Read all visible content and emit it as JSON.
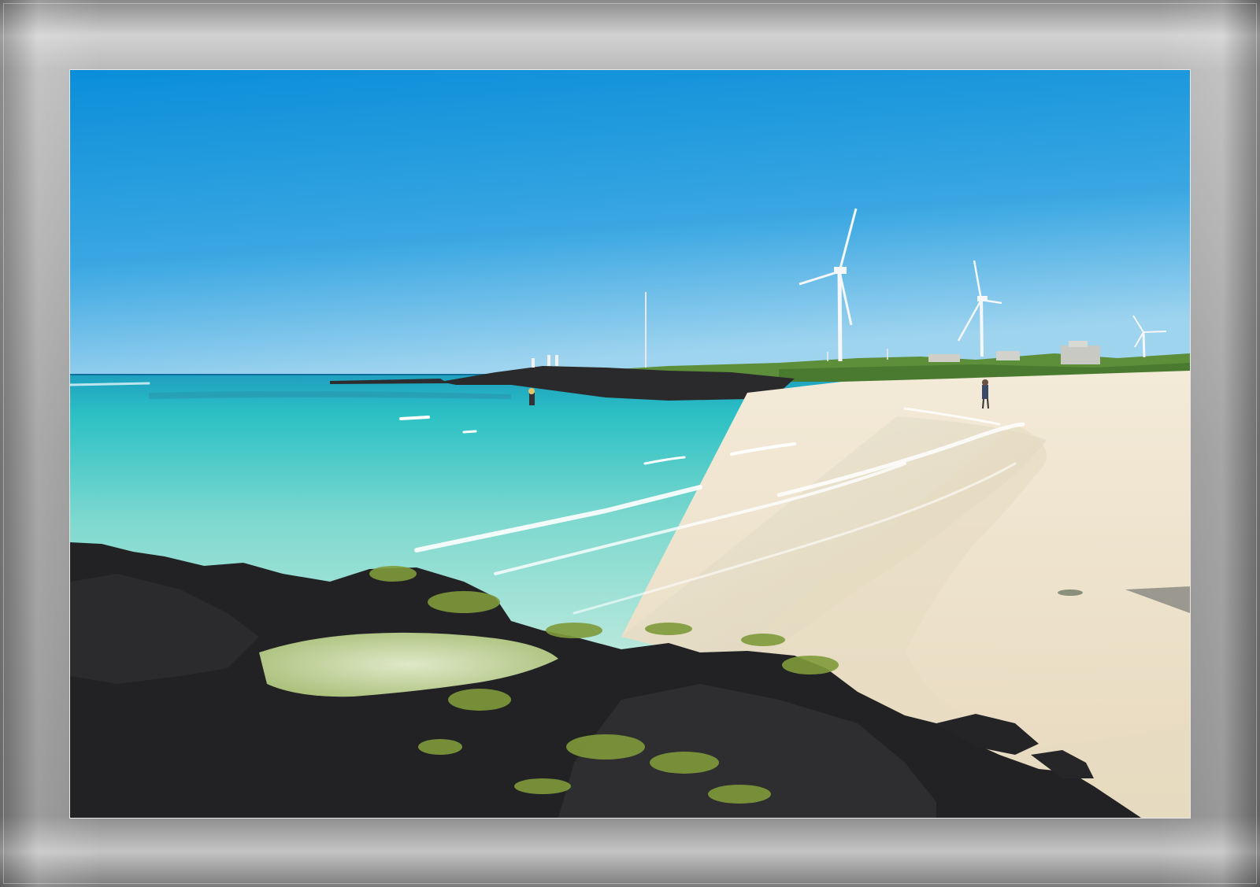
{
  "scene": {
    "sky_top": "#0a8ed9",
    "sky_bottom": "#8fcdee",
    "sea_far": "#2bb9c4",
    "sea_near": "#a9e3d8",
    "sand": "#efe4cf",
    "rock": "#1f1f22",
    "moss": "#7f9a3a",
    "frame_color": "#9a9a9a"
  }
}
